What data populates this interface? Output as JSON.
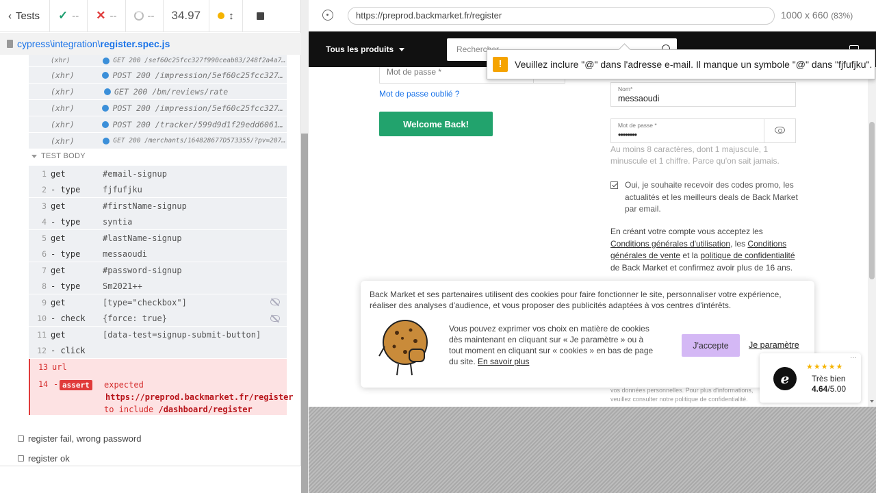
{
  "reporter": {
    "tests_label": "Tests",
    "passed": "--",
    "failed": "--",
    "pending": "--",
    "duration": "34.97",
    "spec_path_prefix": "cypress\\integration\\",
    "spec_file": "register.spec.js",
    "xhr_rows": [
      {
        "type": "(xhr)",
        "msg": "GET 200 /sef60c25fcc327f990ceab83/248f2a4a7..."
      },
      {
        "type": "(xhr)",
        "msg": "POST 200 /impression/5ef60c25fcc327f..."
      },
      {
        "type": "(xhr)",
        "msg": "GET 200 /bm/reviews/rate"
      },
      {
        "type": "(xhr)",
        "msg": "POST 200 /impression/5ef60c25fcc327f..."
      },
      {
        "type": "(xhr)",
        "msg": "POST 200 /tracker/599d9d1f29edd60616..."
      },
      {
        "type": "(xhr)",
        "msg": "GET 200 /merchants/164828677D573355/?pv=207..."
      }
    ],
    "test_body_label": "TEST BODY",
    "commands": [
      {
        "n": "1",
        "name": "get",
        "msg": "#email-signup"
      },
      {
        "n": "2",
        "name": " - type",
        "msg": "fjfufjku"
      },
      {
        "n": "3",
        "name": "get",
        "msg": "#firstName-signup"
      },
      {
        "n": "4",
        "name": " - type",
        "msg": "syntia"
      },
      {
        "n": "5",
        "name": "get",
        "msg": "#lastName-signup"
      },
      {
        "n": "6",
        "name": " - type",
        "msg": "messaoudi"
      },
      {
        "n": "7",
        "name": "get",
        "msg": "#password-signup"
      },
      {
        "n": "8",
        "name": " - type",
        "msg": "Sm2021++"
      },
      {
        "n": "9",
        "name": "get",
        "msg": "[type=\"checkbox\"]"
      },
      {
        "n": "10",
        "name": " - check",
        "msg": "{force: true}"
      },
      {
        "n": "11",
        "name": "get",
        "msg": "[data-test=signup-submit-button]"
      },
      {
        "n": "12",
        "name": " - click",
        "msg": ""
      },
      {
        "n": "13",
        "name": "url",
        "msg": ""
      }
    ],
    "assert": {
      "n": "14",
      "badge": "assert",
      "expected": "expected",
      "url": "https://preprod.backmarket.fr/register",
      "to_include": "to include",
      "target": "/dashboard/register"
    },
    "other_tests": [
      "register fail, wrong password",
      "register ok"
    ]
  },
  "aut_bar": {
    "url": "https://preprod.backmarket.fr/register",
    "viewport": "1000 x 660",
    "zoom": "(83%)"
  },
  "page": {
    "nav_products": "Tous les produits",
    "search_placeholder": "Rechercher",
    "tooltip": "Veuillez inclure \"@\" dans l'adresse e-mail. Il manque un symbole \"@\" dans \"fjfufjku\".",
    "password_placeholder": "Mot de passe *",
    "forgot_password": "Mot de passe oublié ?",
    "welcome_button": "Welcome Back!",
    "nom_label": "Nom*",
    "nom_value": "messaoudi",
    "pw_label": "Mot de passe *",
    "pw_value": "••••••••",
    "pw_hint": "Au moins 8 caractères, dont 1 majuscule, 1 minuscule et 1 chiffre. Parce qu'on sait jamais.",
    "newsletter": "Oui, je souhaite recevoir des codes promo, les actualités et les meilleurs deals de Back Market par email.",
    "legal_1": "En créant votre compte vous acceptez les ",
    "legal_cgu": "Conditions générales d'utilisation",
    "legal_2": ", les ",
    "legal_cgv": "Conditions générales de vente",
    "legal_3": " et la ",
    "legal_privacy": "politique de confidentialité",
    "legal_4": " de Back Market et confirmez avoir plus de 16 ans.",
    "small_legal": "vos données personnelles. Pour plus d'informations, veuillez consulter notre politique de confidentialité."
  },
  "cookie": {
    "intro": "Back Market et ses partenaires utilisent des cookies pour faire fonctionner le site, personnaliser votre expérience, réaliser des analyses d'audience, et vous proposer des publicités adaptées à vos centres d'intérêts.",
    "choice": "Vous pouvez exprimer vos choix en matière de cookies dès maintenant en cliquant sur « Je paramètre » ou à tout moment en cliquant sur « cookies » en bas de page du site.",
    "learn_more": "En savoir plus",
    "accept": "J'accepte",
    "settings": "Je paramètre"
  },
  "trust": {
    "stars": "★★★★★",
    "rating_label": "Très bien",
    "score": "4.64",
    "score_max": "/5.00",
    "badge": "e",
    "menu": "···"
  }
}
